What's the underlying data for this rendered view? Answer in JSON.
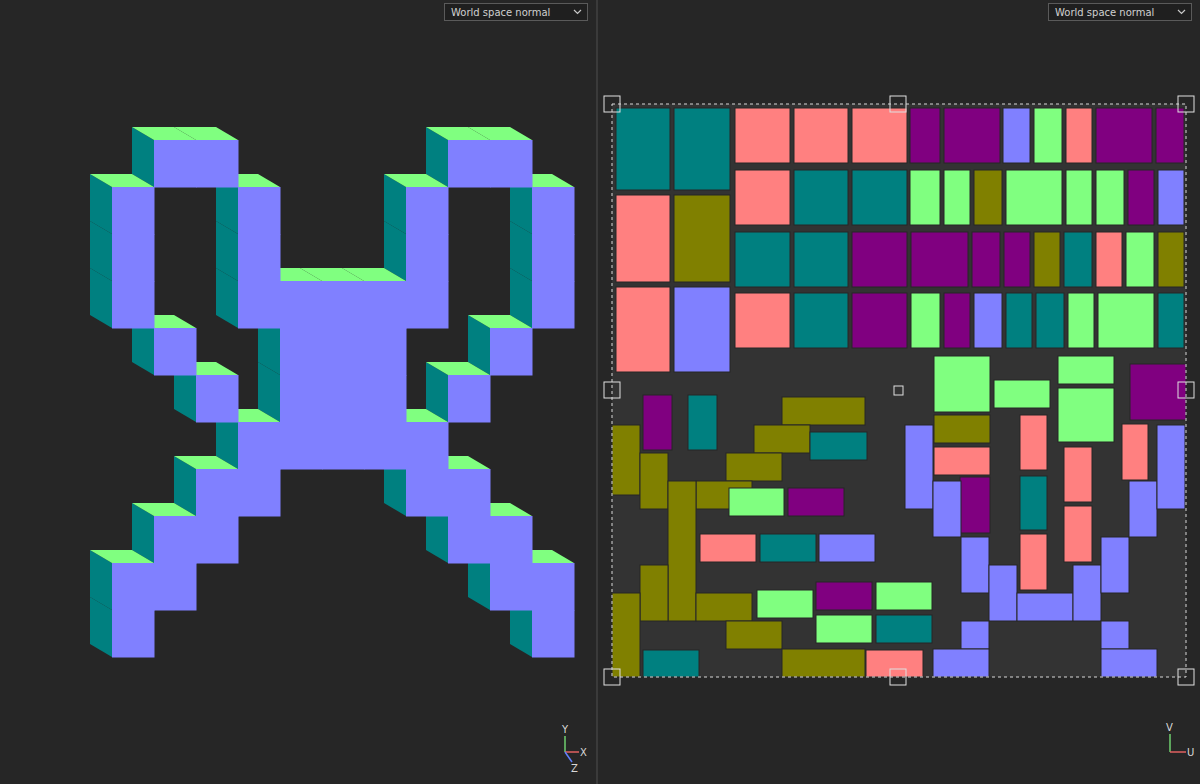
{
  "viewports": [
    {
      "name": "3d-viewport",
      "shading": {
        "value": "World space normal",
        "expanded": false
      },
      "axes": [
        "Y",
        "X",
        "Z"
      ]
    },
    {
      "name": "uv-editor",
      "shading": {
        "value": "World space normal",
        "expanded": false
      },
      "axes": [
        "V",
        "U"
      ]
    }
  ]
}
